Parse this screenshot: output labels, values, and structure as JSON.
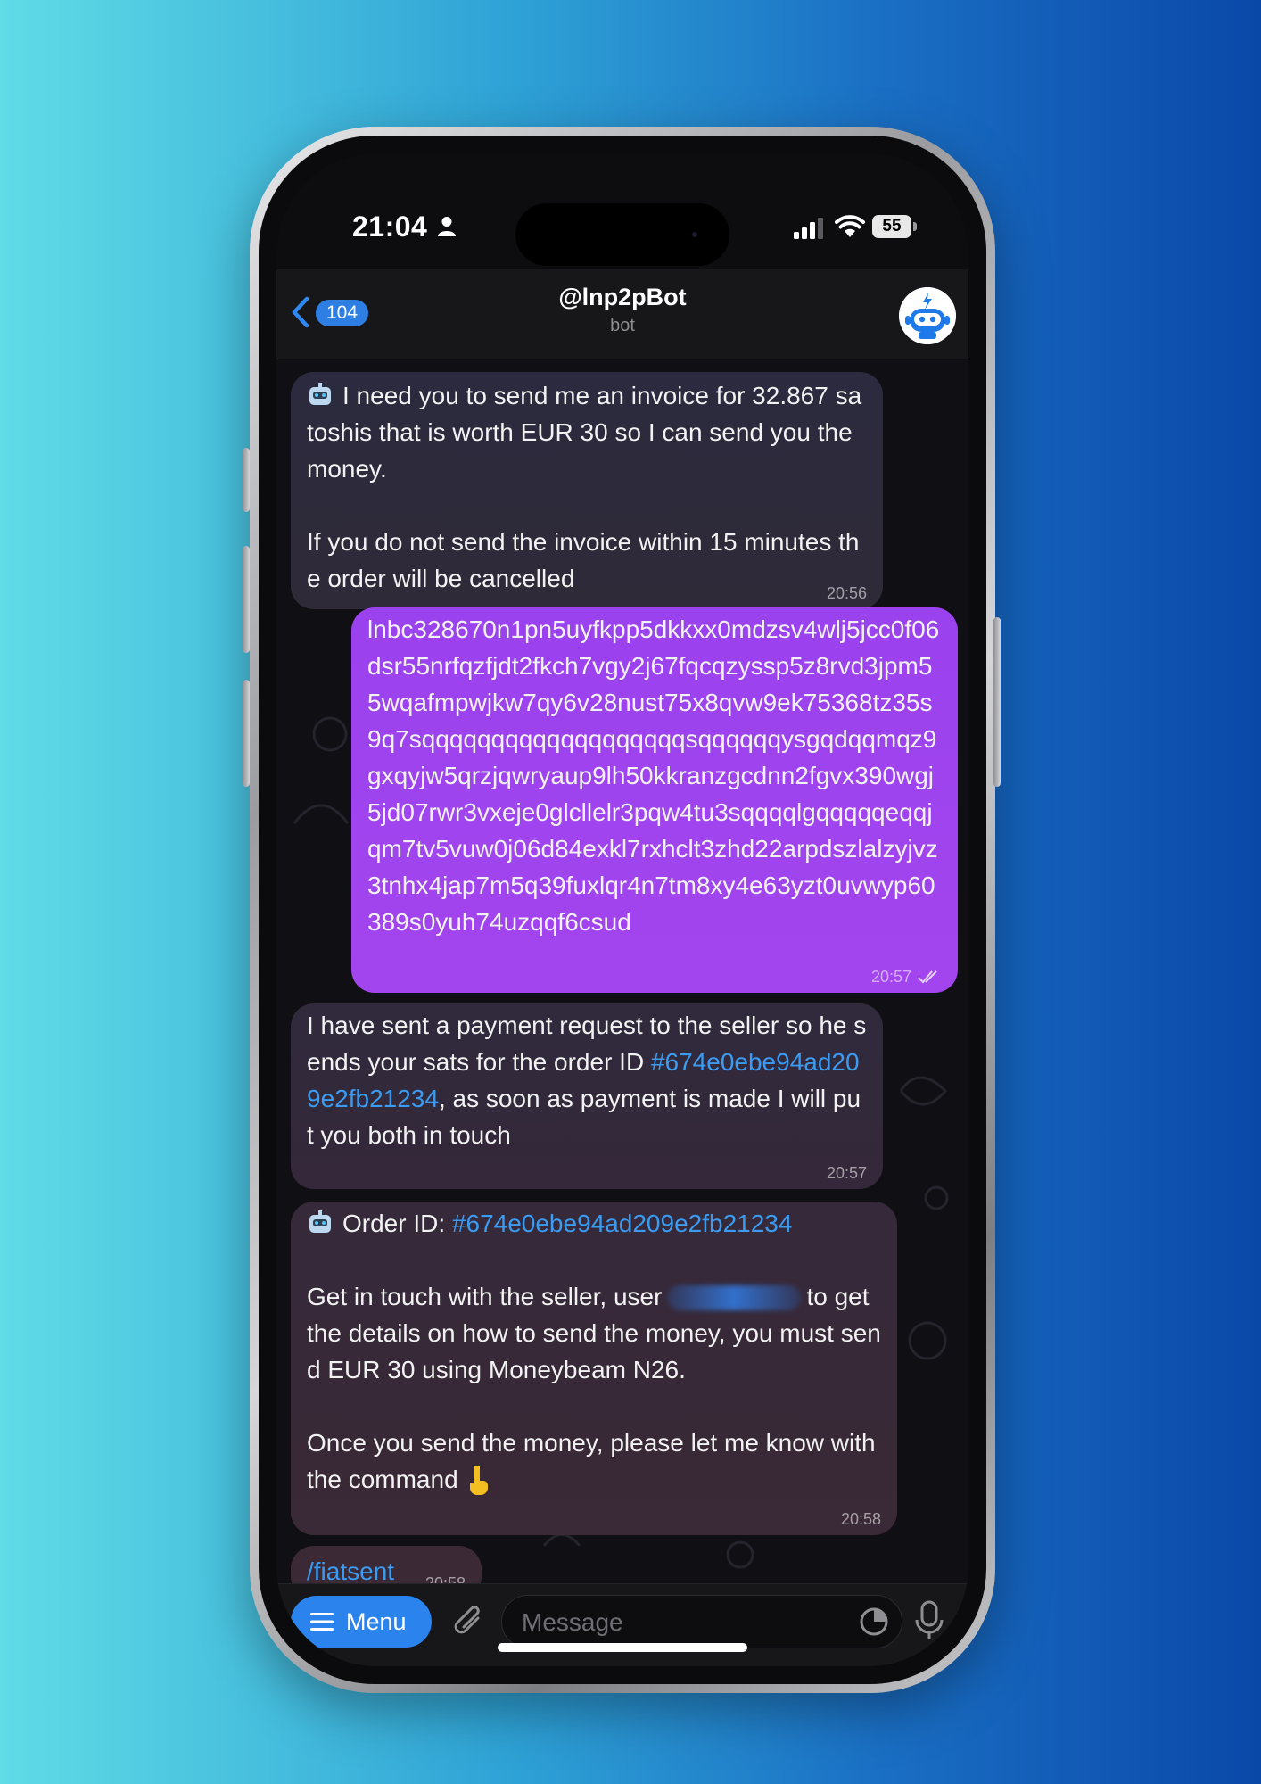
{
  "status_bar": {
    "time": "21:04",
    "battery": "55"
  },
  "header": {
    "back_count": "104",
    "title": "@lnp2pBot",
    "subtitle": "bot"
  },
  "messages": [
    {
      "side": "incoming",
      "text_line1": "I need you to send me an invoice for 32.867 satoshis that is worth EUR 30 so I can send you the money.",
      "text_line2": "If you do not send the invoice within 15 minutes the order will be cancelled",
      "time": "20:56"
    },
    {
      "side": "outgoing",
      "text": "lnbc328670n1pn5uyfkpp5dkkxx0mdzsv4wlj5jcc0f06dsr55nrfqzfjdt2fkch7vgy2j67fqcqzyssp5z8rvd3jpm55wqafmpwjkw7qy6v28nust75x8qvw9ek75368tz35s9q7sqqqqqqqqqqqqqqqqqqqsqqqqqqysgqdqqmqz9gxqyjw5qrzjqwryaup9lh50kkranzgcdnn2fgvx390wgj5jd07rwr3vxeje0glcllelr3pqw4tu3sqqqqlgqqqqqeqqjqm7tv5vuw0j06d84exkl7rxhclt3zhd22arpdszlalzyjvz3tnhx4jap7m5q39fuxlqr4n7tm8xy4e63yzt0uvwyp60389s0yuh74uzqqf6csud",
      "time": "20:57"
    },
    {
      "side": "incoming",
      "text_before": "I have sent a payment request to the seller so he sends your sats for the order ID ",
      "link": "#674e0ebe94ad209e2fb21234",
      "text_after": ", as soon as payment is made I will put you both in touch",
      "time": "20:57"
    },
    {
      "side": "incoming",
      "order_label": "Order ID: ",
      "order_link": "#674e0ebe94ad209e2fb21234",
      "para1_before": "Get in touch with the seller, user",
      "para1_after": "to get the details on how to send the money, you must send EUR 30 using Moneybeam N26.",
      "para2": "Once you send the money, please let me know with the command",
      "time": "20:58"
    },
    {
      "side": "incoming",
      "command": "/fiatsent",
      "time": "20:58"
    }
  ],
  "input_bar": {
    "menu_label": "Menu",
    "placeholder": "Message"
  },
  "colors": {
    "outgoing_bubble": "#a045ee",
    "link": "#3b9bf0",
    "accent": "#2b84ee"
  }
}
